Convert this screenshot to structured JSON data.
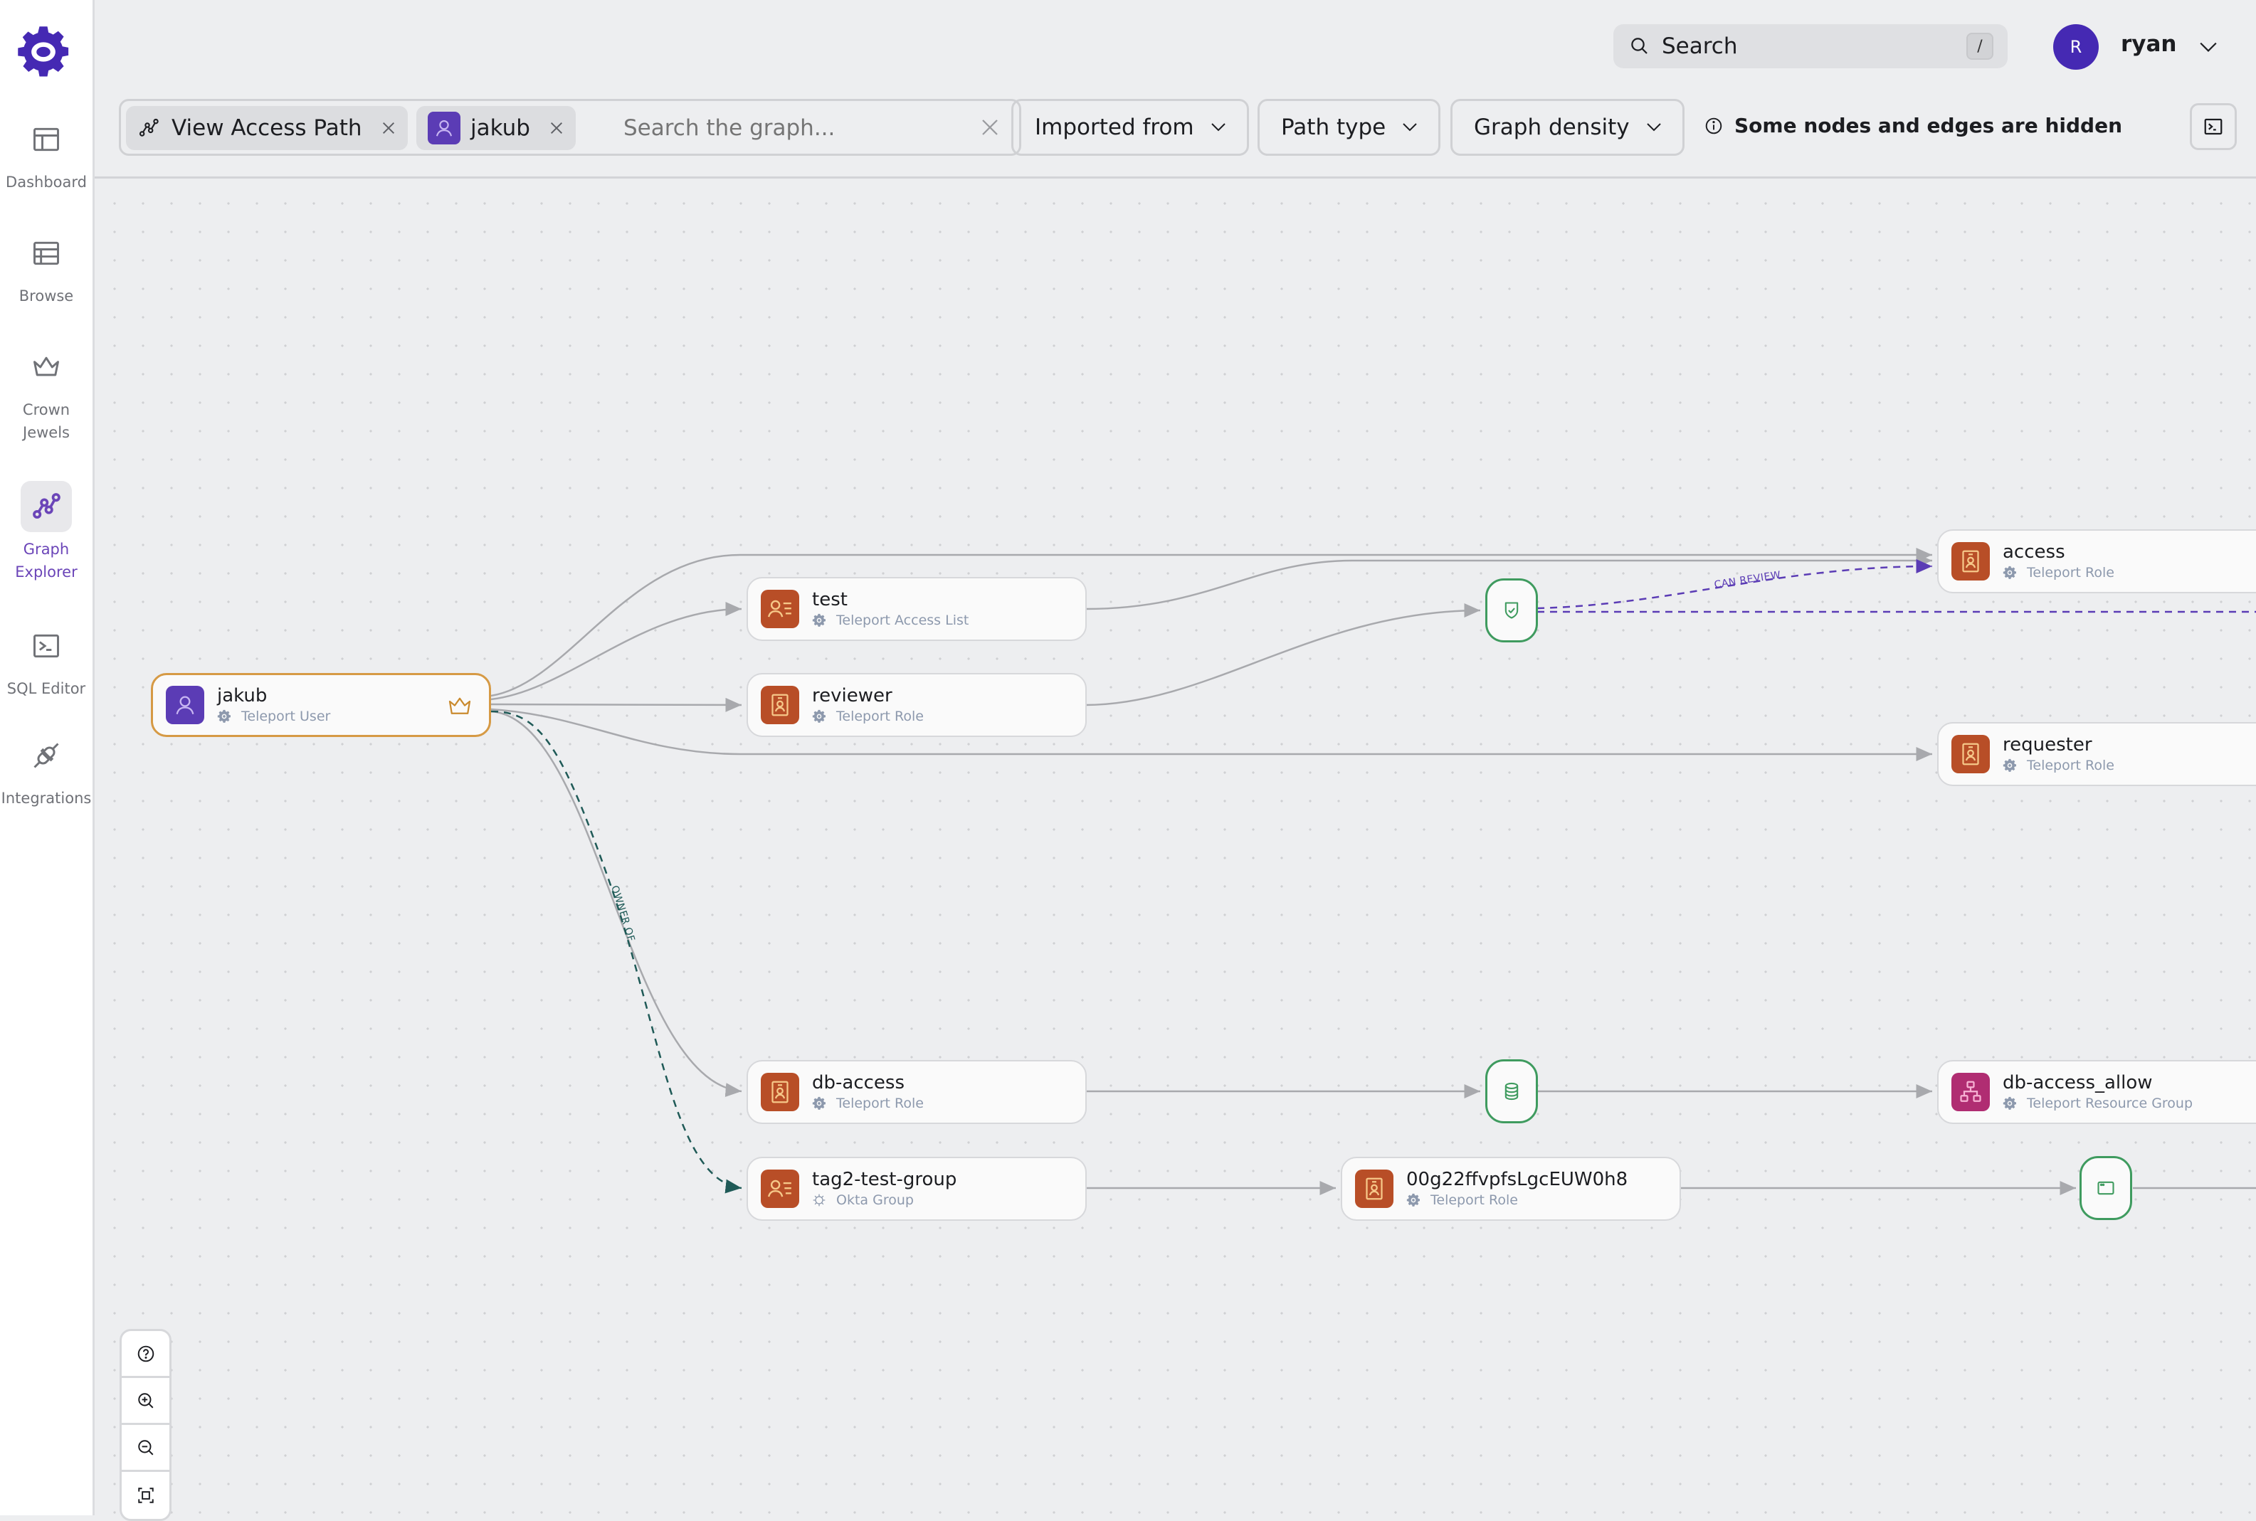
{
  "sidebar": {
    "items": [
      {
        "id": "dashboard",
        "label": "Dashboard",
        "icon": "dashboard-icon"
      },
      {
        "id": "browse",
        "label": "Browse",
        "icon": "table-icon"
      },
      {
        "id": "crown-jewels",
        "label": "Crown\nJewels",
        "label_line1": "Crown",
        "label_line2": "Jewels",
        "icon": "crown-icon"
      },
      {
        "id": "graph-explorer",
        "label_line1": "Graph",
        "label_line2": "Explorer",
        "icon": "graph-icon",
        "active": true
      },
      {
        "id": "sql-editor",
        "label": "SQL Editor",
        "icon": "terminal-icon"
      },
      {
        "id": "integrations",
        "label": "Integrations",
        "icon": "plug-icon"
      }
    ]
  },
  "header": {
    "search_label": "Search",
    "search_shortcut": "/",
    "user": {
      "initial": "R",
      "name": "ryan"
    }
  },
  "filters": {
    "chips": [
      {
        "label": "View Access Path",
        "icon": "graph-icon"
      },
      {
        "label": "jakub",
        "icon": "user-icon"
      }
    ],
    "search_placeholder": "Search the graph...",
    "dropdowns": [
      {
        "label": "Imported from"
      },
      {
        "label": "Path type"
      },
      {
        "label": "Graph density"
      }
    ],
    "hidden_notice": "Some nodes and edges are hidden"
  },
  "graph": {
    "nodes": [
      {
        "id": "jakub",
        "name": "jakub",
        "type": "Teleport User",
        "source_icon": "gear-icon",
        "kind": "user",
        "selected": true,
        "crown_jewel": true
      },
      {
        "id": "test",
        "name": "test",
        "type": "Teleport Access List",
        "source_icon": "gear-icon",
        "kind": "access-list"
      },
      {
        "id": "reviewer",
        "name": "reviewer",
        "type": "Teleport Role",
        "source_icon": "gear-icon",
        "kind": "role"
      },
      {
        "id": "access",
        "name": "access",
        "type": "Teleport Role",
        "source_icon": "gear-icon",
        "kind": "role"
      },
      {
        "id": "requester",
        "name": "requester",
        "type": "Teleport Role",
        "source_icon": "gear-icon",
        "kind": "role"
      },
      {
        "id": "db-access",
        "name": "db-access",
        "type": "Teleport Role",
        "source_icon": "gear-icon",
        "kind": "role"
      },
      {
        "id": "tag2-test-group",
        "name": "tag2-test-group",
        "type": "Okta Group",
        "source_icon": "okta-icon",
        "kind": "access-list"
      },
      {
        "id": "okta-role",
        "name": "00g22ffvpfsLgcEUW0h8",
        "type": "Teleport Role",
        "source_icon": "gear-icon",
        "kind": "role"
      },
      {
        "id": "db-access-allow",
        "name": "db-access_allow",
        "type": "Teleport Resource Group",
        "source_icon": "gear-icon",
        "kind": "resource-group"
      }
    ],
    "action_nodes": [
      {
        "id": "review-action",
        "icon": "shield-check-icon"
      },
      {
        "id": "db-action",
        "icon": "database-icon"
      },
      {
        "id": "app-action",
        "icon": "app-window-icon"
      }
    ],
    "edge_labels": {
      "can_review": "CAN REVIEW",
      "owner_of": "OWNER OF"
    },
    "colors": {
      "accent": "#5b3cb5",
      "role": "#b84e27",
      "resource_group": "#b02d72",
      "action_border": "#3f9b5f",
      "selected_border": "#d69a45",
      "can_review_edge": "#5b3cb5",
      "owner_of_edge": "#1f5a57"
    }
  },
  "zoom_controls": [
    "help",
    "zoom-in",
    "zoom-out",
    "fit-view"
  ]
}
